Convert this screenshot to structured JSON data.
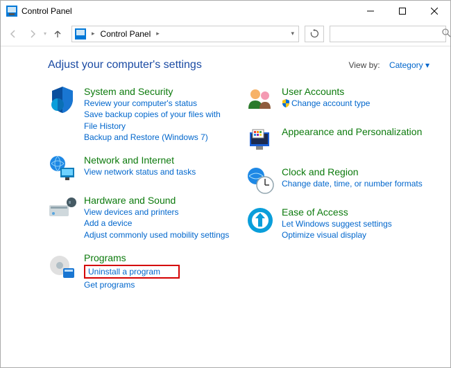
{
  "window": {
    "title": "Control Panel"
  },
  "breadcrumb": {
    "label": "Control Panel"
  },
  "search": {
    "placeholder": ""
  },
  "header": {
    "title": "Adjust your computer's settings"
  },
  "viewby": {
    "label": "View by:",
    "value": "Category"
  },
  "left": [
    {
      "title": "System and Security",
      "links": [
        "Review your computer's status",
        "Save backup copies of your files with File History",
        "Backup and Restore (Windows 7)"
      ]
    },
    {
      "title": "Network and Internet",
      "links": [
        "View network status and tasks"
      ]
    },
    {
      "title": "Hardware and Sound",
      "links": [
        "View devices and printers",
        "Add a device",
        "Adjust commonly used mobility settings"
      ]
    },
    {
      "title": "Programs",
      "links": [
        "Uninstall a program",
        "Get programs"
      ]
    }
  ],
  "right": [
    {
      "title": "User Accounts",
      "links": [
        "Change account type"
      ],
      "shield": [
        true
      ]
    },
    {
      "title": "Appearance and Personalization",
      "links": []
    },
    {
      "title": "Clock and Region",
      "links": [
        "Change date, time, or number formats"
      ]
    },
    {
      "title": "Ease of Access",
      "links": [
        "Let Windows suggest settings",
        "Optimize visual display"
      ]
    }
  ]
}
